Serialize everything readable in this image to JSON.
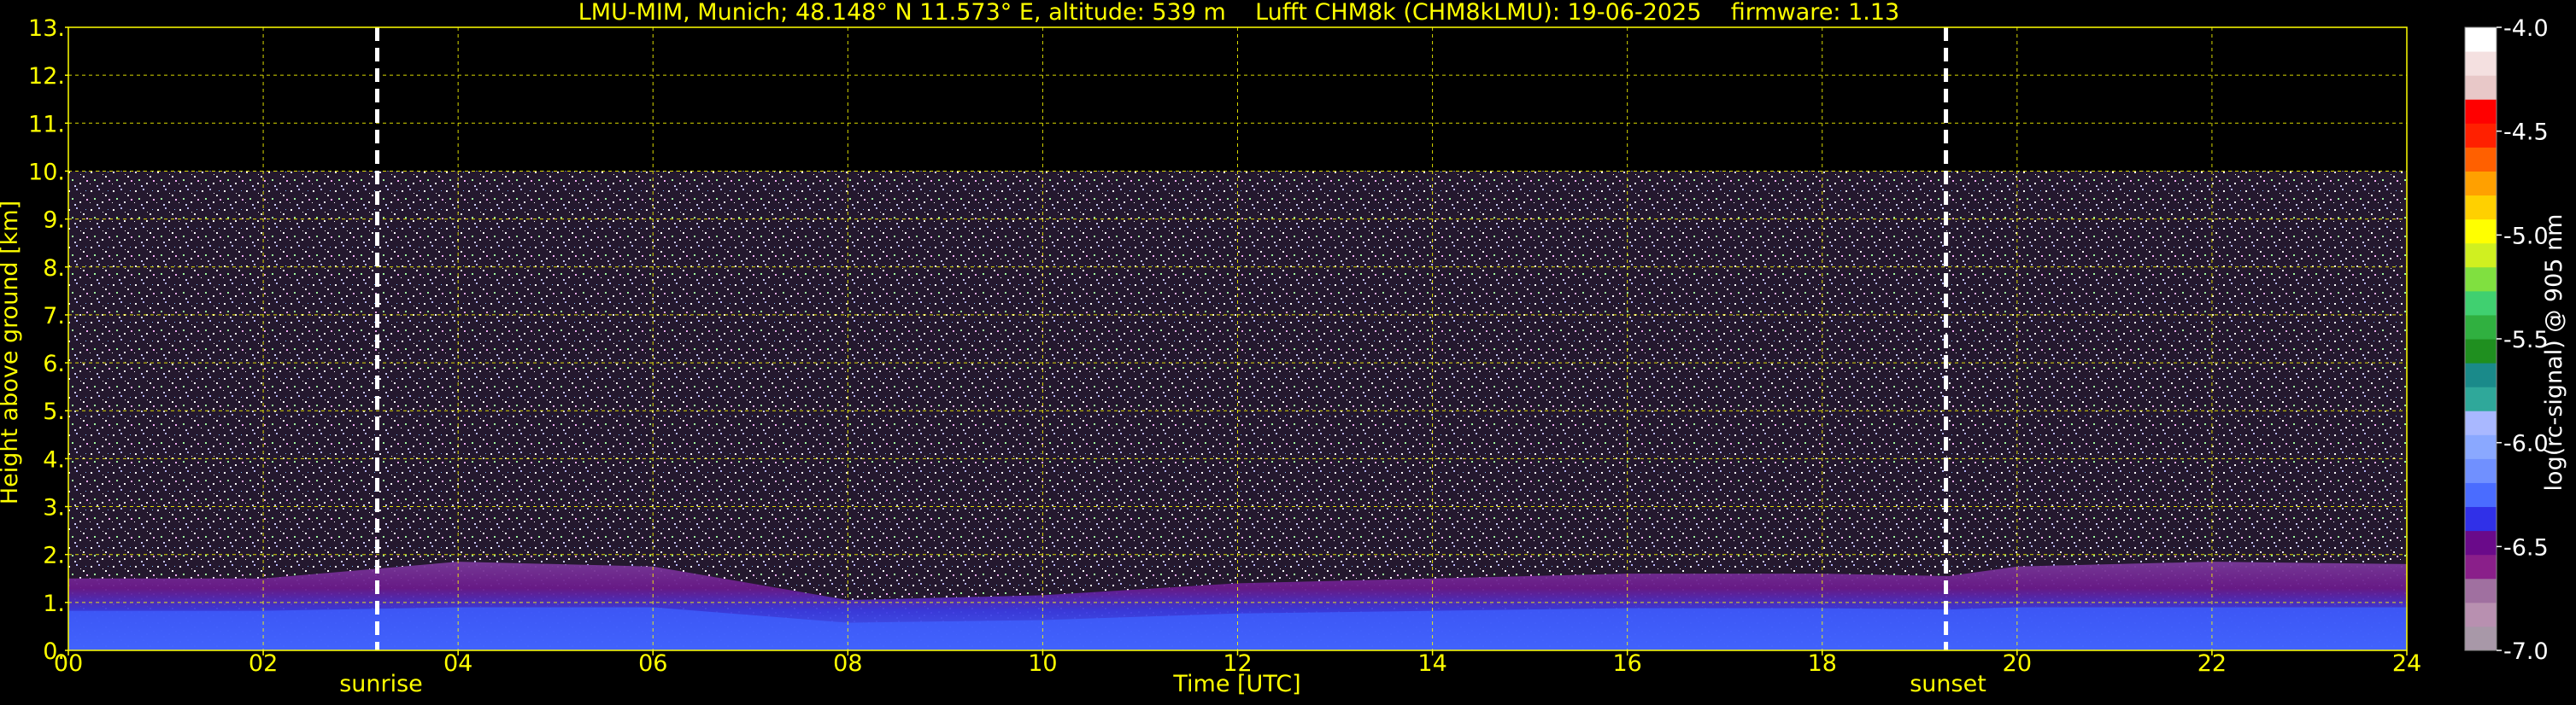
{
  "chart_data": {
    "type": "heatmap",
    "title": "LMU-MIM, Munich; 48.148° N 11.573° E, altitude: 539 m    Lufft CHM8k (CHM8kLMU): 19-06-2025    firmware: 1.13",
    "xlabel": "Time [UTC]",
    "ylabel": "Height above ground [km]",
    "xlim": [
      0,
      24
    ],
    "ylim": [
      0,
      13
    ],
    "x_ticks": [
      "00",
      "02",
      "04",
      "06",
      "08",
      "10",
      "12",
      "14",
      "16",
      "18",
      "20",
      "22",
      "24"
    ],
    "y_ticks": [
      "0.",
      "1.",
      "2.",
      "3.",
      "4.",
      "5.",
      "6.",
      "7.",
      "8.",
      "9.",
      "10.",
      "11.",
      "12.",
      "13."
    ],
    "grid": true,
    "data_ceiling_km": 10,
    "events": [
      {
        "label": "sunrise",
        "time_utc": 3.17
      },
      {
        "label": "sunset",
        "time_utc": 19.27
      }
    ],
    "layers": [
      {
        "name": "aerosol boundary layer",
        "top_km_profile": [
          [
            0,
            1.5
          ],
          [
            2,
            1.5
          ],
          [
            4,
            1.85
          ],
          [
            6,
            1.75
          ],
          [
            8,
            1.05
          ],
          [
            10,
            1.15
          ],
          [
            12,
            1.4
          ],
          [
            14,
            1.5
          ],
          [
            16,
            1.6
          ],
          [
            18,
            1.6
          ],
          [
            19.3,
            1.55
          ],
          [
            20,
            1.75
          ],
          [
            22,
            1.85
          ],
          [
            24,
            1.8
          ]
        ]
      }
    ],
    "colorbar": {
      "label": "log(rc-signal) @ 905 nm",
      "range": [
        -7.0,
        -4.0
      ],
      "ticks": [
        "-4.0",
        "-4.5",
        "-5.0",
        "-5.5",
        "-6.0",
        "-6.5",
        "-7.0"
      ],
      "colors": [
        "#a898a8",
        "#b890b0",
        "#a070a0",
        "#8a1f8a",
        "#6a0a8a",
        "#3030e8",
        "#4a6cff",
        "#7090ff",
        "#8aa8ff",
        "#a9b8ff",
        "#2fa89a",
        "#1a8a8a",
        "#1f8f1f",
        "#30b040",
        "#40d070",
        "#80e040",
        "#d0f020",
        "#ffff00",
        "#ffd000",
        "#ffa000",
        "#ff6000",
        "#ff2000",
        "#ff0000",
        "#e8c8c8",
        "#f4e0e0",
        "#ffffff"
      ]
    }
  }
}
